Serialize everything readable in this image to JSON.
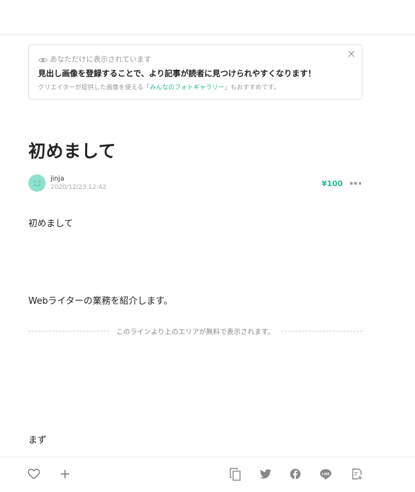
{
  "notice": {
    "visibility_text": "あなただけに表示されています",
    "title": "見出し画像を登録することで、より記事が読者に見つけられやすくなります！",
    "sub_prefix": "クリエイターが提供した画像を使える「",
    "sub_link": "みんなのフォトギャラリー",
    "sub_suffix": "」もおすすめです。"
  },
  "article": {
    "title": "初めまして",
    "author": "jinja",
    "date": "2020/12/23 12:42",
    "price": "¥100",
    "paragraphs": [
      "初めまして",
      "Webライターの業務を紹介します。"
    ],
    "paywall_text": "このラインより上のエリアが無料で表示されます。",
    "after_paywall": "まず"
  },
  "colors": {
    "accent": "#2cb696",
    "avatar_bg": "#8fe0cf"
  }
}
